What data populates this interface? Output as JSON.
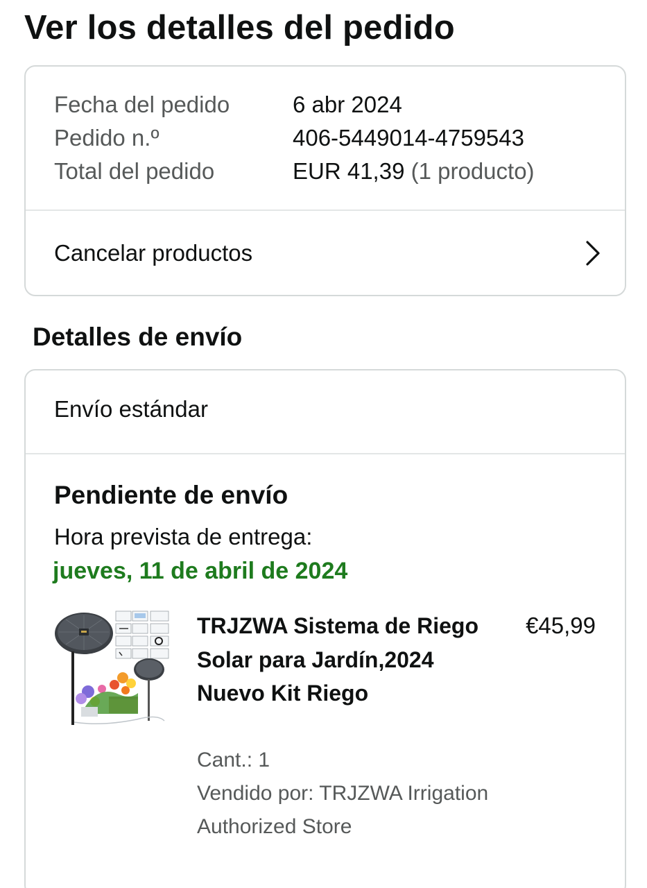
{
  "page": {
    "title": "Ver los detalles del pedido"
  },
  "summary": {
    "order_date_label": "Fecha del pedido",
    "order_date_value": "6 abr 2024",
    "order_number_label": "Pedido n.º",
    "order_number_value": "406-5449014-4759543",
    "order_total_label": "Total del pedido",
    "order_total_value": "EUR 41,39",
    "order_total_count": "(1 producto)",
    "cancel_label": "Cancelar productos",
    "cancel_icon": "chevron-right-icon"
  },
  "shipping": {
    "section_title": "Detalles de envío",
    "method": "Envío estándar",
    "status": "Pendiente de envío",
    "delivery_label": "Hora prevista de entrega:",
    "delivery_date": "jueves, 11 de abril de 2024",
    "delivery_date_color": "#1e7b1e"
  },
  "product": {
    "title": "TRJZWA Sistema de Riego Solar para Jardín,2024 Nuevo Kit Riego",
    "price": "€45,99",
    "quantity": "Cant.: 1",
    "seller": "Vendido por: TRJZWA Irrigation Authorized Store",
    "image_icon": "solar-irrigation-kit-image"
  },
  "colors": {
    "text_primary": "#0f1111",
    "text_secondary": "#565959",
    "border": "#d5d9d9"
  }
}
